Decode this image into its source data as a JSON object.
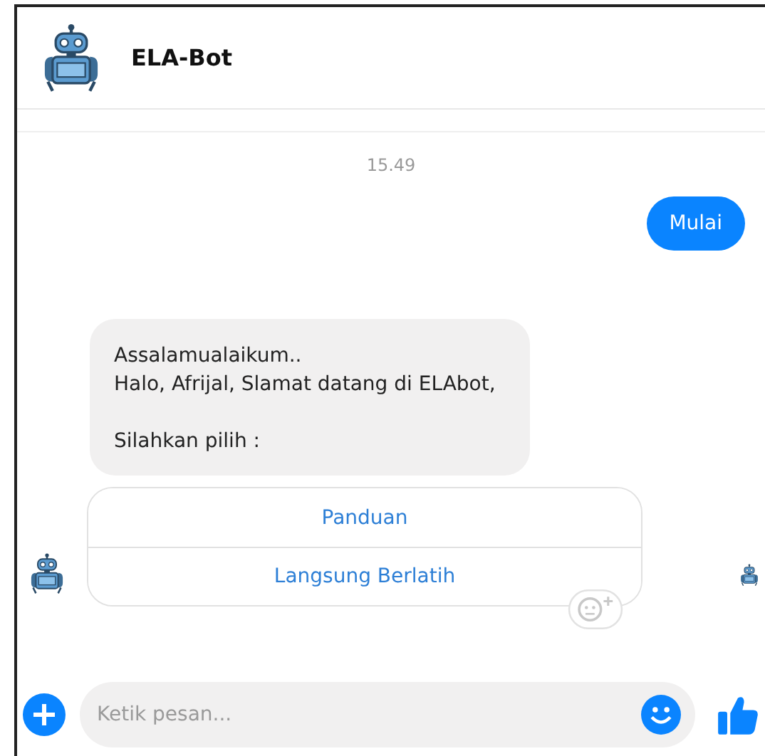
{
  "header": {
    "title": "ELA-Bot"
  },
  "timestamp": "15.49",
  "messages": [
    {
      "kind": "outgoing",
      "text": "Mulai"
    },
    {
      "kind": "incoming",
      "text": "Assalamualaikum..\nHalo, Afrijal, Slamat datang di ELAbot,\n\nSilahkan pilih :"
    }
  ],
  "quick_replies": [
    "Panduan",
    "Langsung Berlatih"
  ],
  "composer": {
    "placeholder": "Ketik pesan..."
  }
}
